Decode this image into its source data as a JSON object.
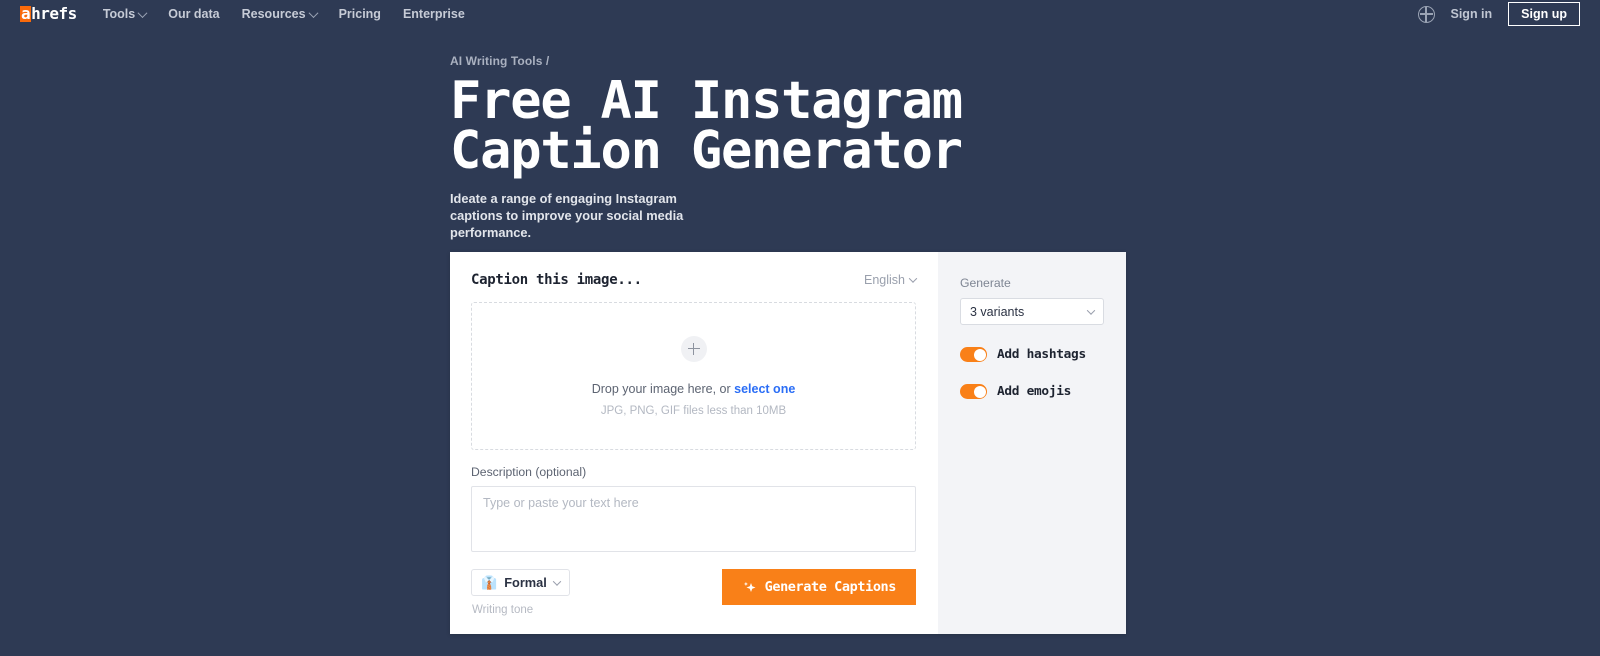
{
  "nav": {
    "logo": {
      "highlight": "a",
      "rest": "hrefs"
    },
    "items": [
      {
        "label": "Tools",
        "has_chevron": true
      },
      {
        "label": "Our data",
        "has_chevron": false
      },
      {
        "label": "Resources",
        "has_chevron": true
      },
      {
        "label": "Pricing",
        "has_chevron": false
      },
      {
        "label": "Enterprise",
        "has_chevron": false
      }
    ],
    "language_icon": "globe-icon",
    "sign_in": "Sign in",
    "sign_up": "Sign up"
  },
  "hero": {
    "breadcrumb": "AI Writing Tools /",
    "title": "Free AI Instagram Caption Generator",
    "subtitle": "Ideate a range of engaging Instagram captions to improve your social media performance."
  },
  "card": {
    "title": "Caption this image...",
    "language": "English",
    "dropzone": {
      "plus_icon": "plus-icon",
      "line1_prefix": "Drop your image here, or ",
      "line1_link": "select one",
      "line2": "JPG, PNG, GIF files less than 10MB"
    },
    "description": {
      "label": "Description (optional)",
      "placeholder": "Type or paste your text here",
      "value": ""
    },
    "tone": {
      "emoji": "👔",
      "value": "Formal",
      "caption": "Writing tone"
    },
    "generate_button": {
      "icon": "sparkle-icon",
      "label": "Generate Captions"
    }
  },
  "sidebar": {
    "generate_label": "Generate",
    "variants_value": "3 variants",
    "toggles": [
      {
        "label": "Add hashtags",
        "on": true
      },
      {
        "label": "Add emojis",
        "on": true
      }
    ]
  },
  "colors": {
    "navy": "#2e3a54",
    "orange": "#f98018",
    "link_blue": "#2b6ef6",
    "panel_gray": "#f3f4f7"
  }
}
